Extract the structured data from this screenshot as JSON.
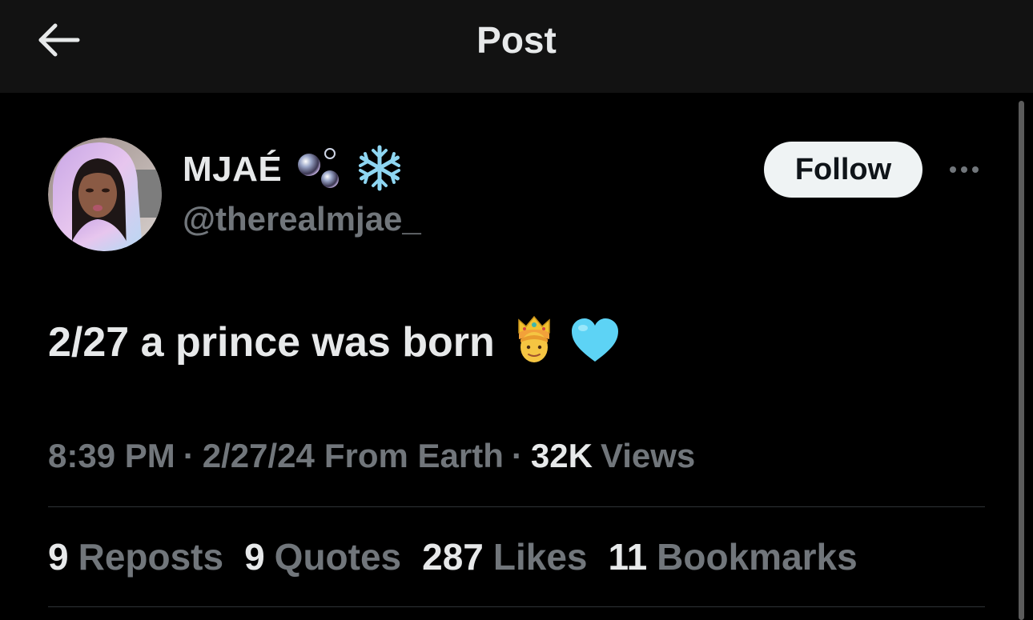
{
  "header": {
    "title": "Post",
    "back_icon": "arrow-left-icon"
  },
  "author": {
    "display_name": "MJAÉ",
    "name_emojis": [
      "bubbles-icon",
      "snowflake-icon"
    ],
    "handle": "@therealmjae_",
    "avatar_icon": "user-avatar"
  },
  "actions": {
    "follow_label": "Follow",
    "more_icon": "more-horizontal-icon"
  },
  "post": {
    "text": "2/27 a prince was born",
    "emojis": [
      "prince-icon",
      "light-blue-heart-icon"
    ],
    "time": "8:39 PM",
    "date": "2/27/24",
    "location": "From Earth",
    "views_count": "32K",
    "views_label": "Views",
    "separator": "·"
  },
  "stats": [
    {
      "count": "9",
      "label": "Reposts"
    },
    {
      "count": "9",
      "label": "Quotes"
    },
    {
      "count": "287",
      "label": "Likes"
    },
    {
      "count": "11",
      "label": "Bookmarks"
    }
  ],
  "colors": {
    "background": "#000000",
    "header_background": "#121212",
    "primary_text": "#e7e9ea",
    "secondary_text": "#71767b",
    "divider": "#2f3336",
    "follow_button_bg": "#eff3f4",
    "follow_button_text": "#0f1419",
    "heart": "#5dd3f5"
  }
}
